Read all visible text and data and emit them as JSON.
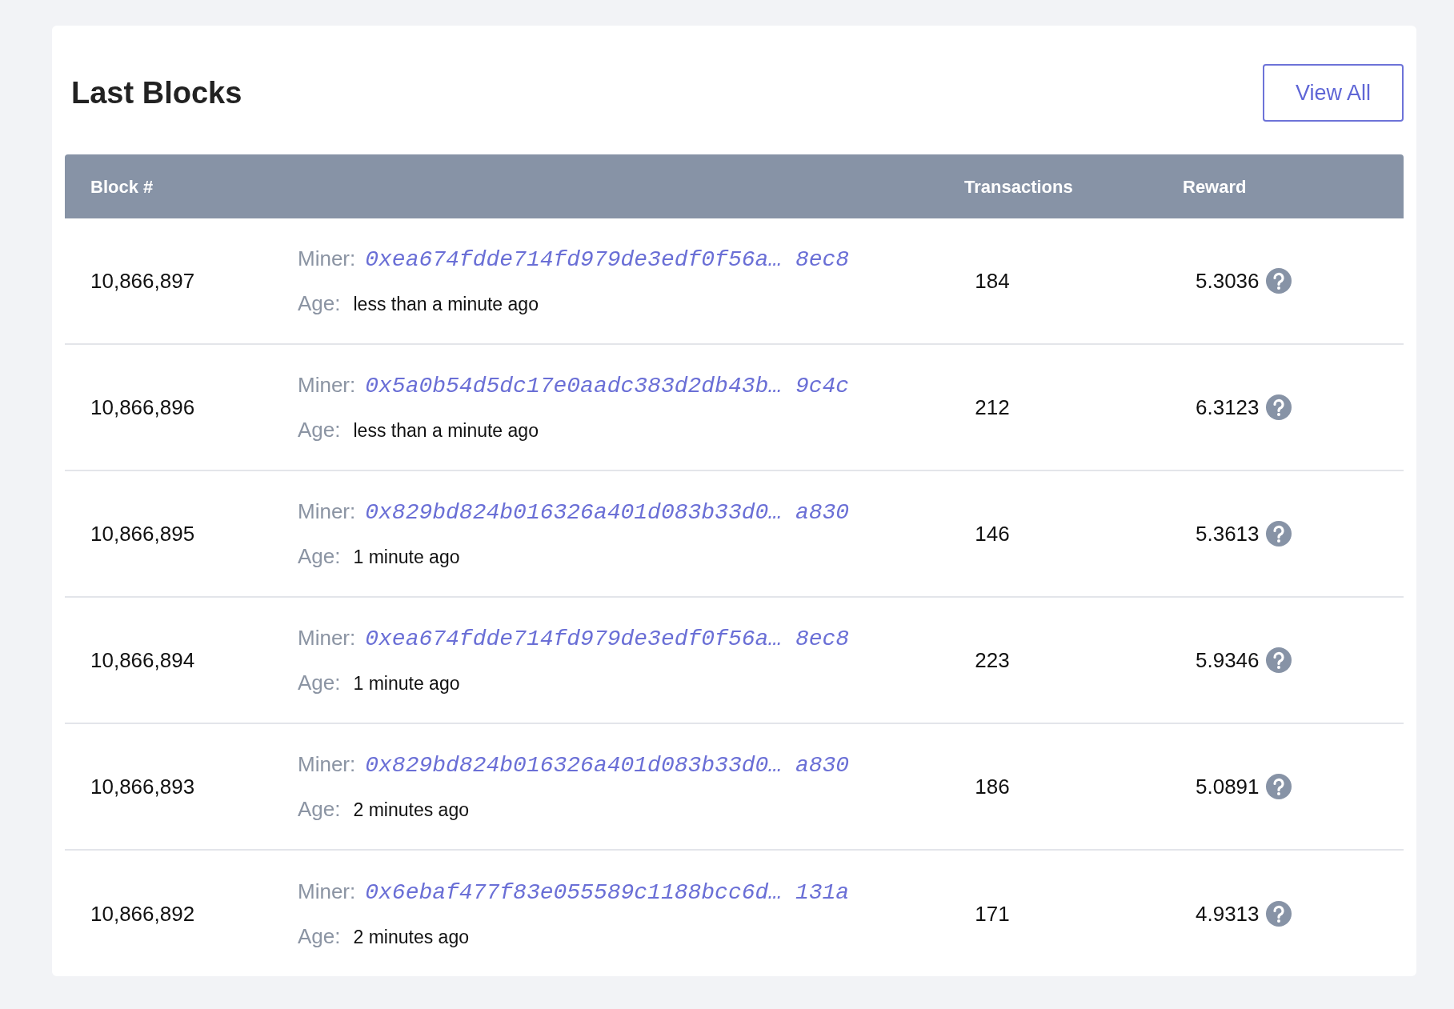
{
  "title": "Last Blocks",
  "view_all_button": "View All",
  "table": {
    "columns": [
      "Block #",
      "Transactions",
      "Reward"
    ],
    "rows": [
      {
        "block": "10,866,897",
        "miner_label": "Miner:",
        "miner": "0xea674fdde714fd979de3edf0f56a… 8ec8",
        "age_label": "Age:",
        "age": "less than a minute ago",
        "transactions": "184",
        "reward": "5.3036"
      },
      {
        "block": "10,866,896",
        "miner_label": "Miner:",
        "miner": "0x5a0b54d5dc17e0aadc383d2db43b… 9c4c",
        "age_label": "Age:",
        "age": "less than a minute ago",
        "transactions": "212",
        "reward": "6.3123"
      },
      {
        "block": "10,866,895",
        "miner_label": "Miner:",
        "miner": "0x829bd824b016326a401d083b33d0… a830",
        "age_label": "Age:",
        "age": "1 minute ago",
        "transactions": "146",
        "reward": "5.3613"
      },
      {
        "block": "10,866,894",
        "miner_label": "Miner:",
        "miner": "0xea674fdde714fd979de3edf0f56a… 8ec8",
        "age_label": "Age:",
        "age": "1 minute ago",
        "transactions": "223",
        "reward": "5.9346"
      },
      {
        "block": "10,866,893",
        "miner_label": "Miner:",
        "miner": "0x829bd824b016326a401d083b33d0… a830",
        "age_label": "Age:",
        "age": "2 minutes ago",
        "transactions": "186",
        "reward": "5.0891"
      },
      {
        "block": "10,866,892",
        "miner_label": "Miner:",
        "miner": "0x6ebaf477f83e055589c1188bcc6d… 131a",
        "age_label": "Age:",
        "age": "2 minutes ago",
        "transactions": "171",
        "reward": "4.9313"
      }
    ]
  }
}
